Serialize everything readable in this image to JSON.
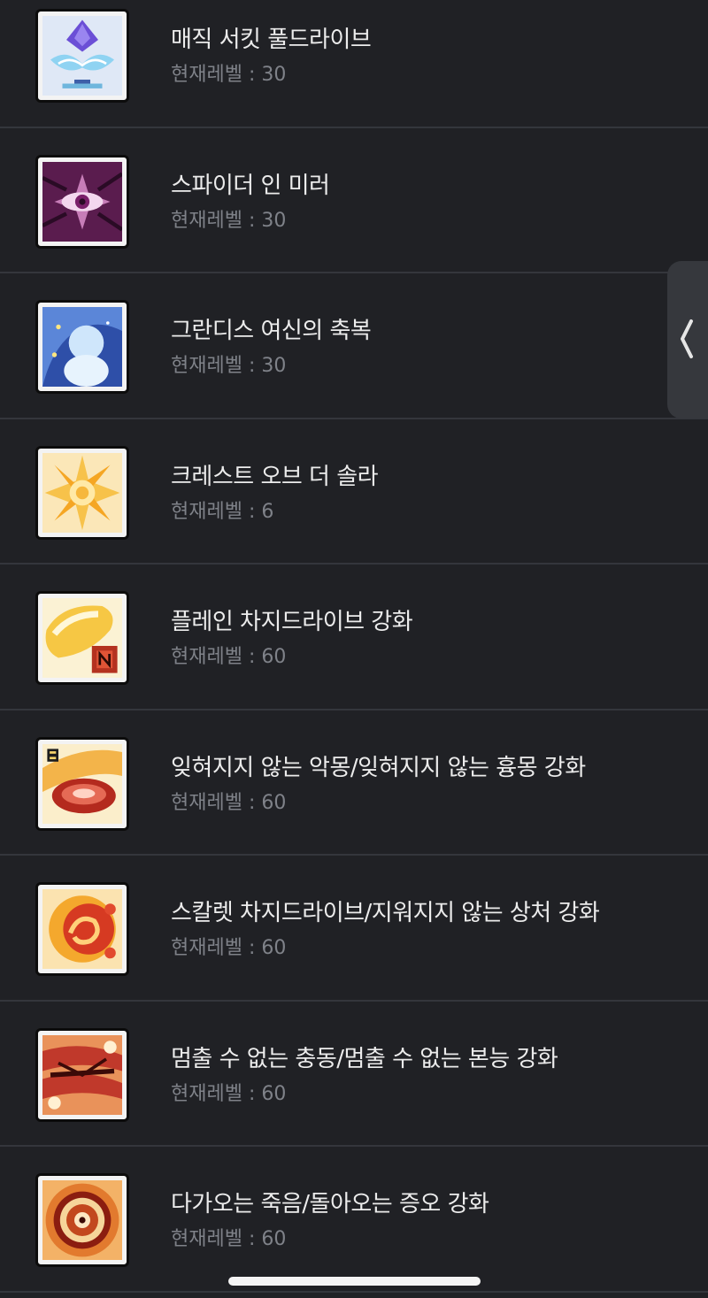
{
  "skills": [
    {
      "name": "매직 서킷 풀드라이브",
      "level_text": "현재레벨 : 30",
      "icon": "magic-circuit-icon"
    },
    {
      "name": "스파이더 인 미러",
      "level_text": "현재레벨 : 30",
      "icon": "spider-in-mirror-icon"
    },
    {
      "name": "그란디스 여신의 축복",
      "level_text": "현재레벨 : 30",
      "icon": "grandis-goddess-icon"
    },
    {
      "name": "크레스트 오브 더 솔라",
      "level_text": "현재레벨 : 6",
      "icon": "crest-of-solar-icon"
    },
    {
      "name": "플레인 차지드라이브 강화",
      "level_text": "현재레벨 : 60",
      "icon": "plain-chargedrive-icon"
    },
    {
      "name": "잊혀지지 않는 악몽/잊혀지지 않는 흉몽 강화",
      "level_text": "현재레벨 : 60",
      "icon": "unforgettable-nightmare-icon"
    },
    {
      "name": "스칼렛 차지드라이브/지워지지 않는 상처 강화",
      "level_text": "현재레벨 : 60",
      "icon": "scarlet-chargedrive-icon"
    },
    {
      "name": "멈출 수 없는 충동/멈출 수 없는 본능 강화",
      "level_text": "현재레벨 : 60",
      "icon": "unstoppable-impulse-icon"
    },
    {
      "name": "다가오는 죽음/돌아오는 증오 강화",
      "level_text": "현재레벨 : 60",
      "icon": "approaching-death-icon"
    }
  ],
  "side_tab": {
    "icon": "chevron-left-icon"
  },
  "colors": {
    "background": "#202125",
    "divider": "#34363c",
    "name_text": "#ececec",
    "level_text": "#7f8289"
  }
}
